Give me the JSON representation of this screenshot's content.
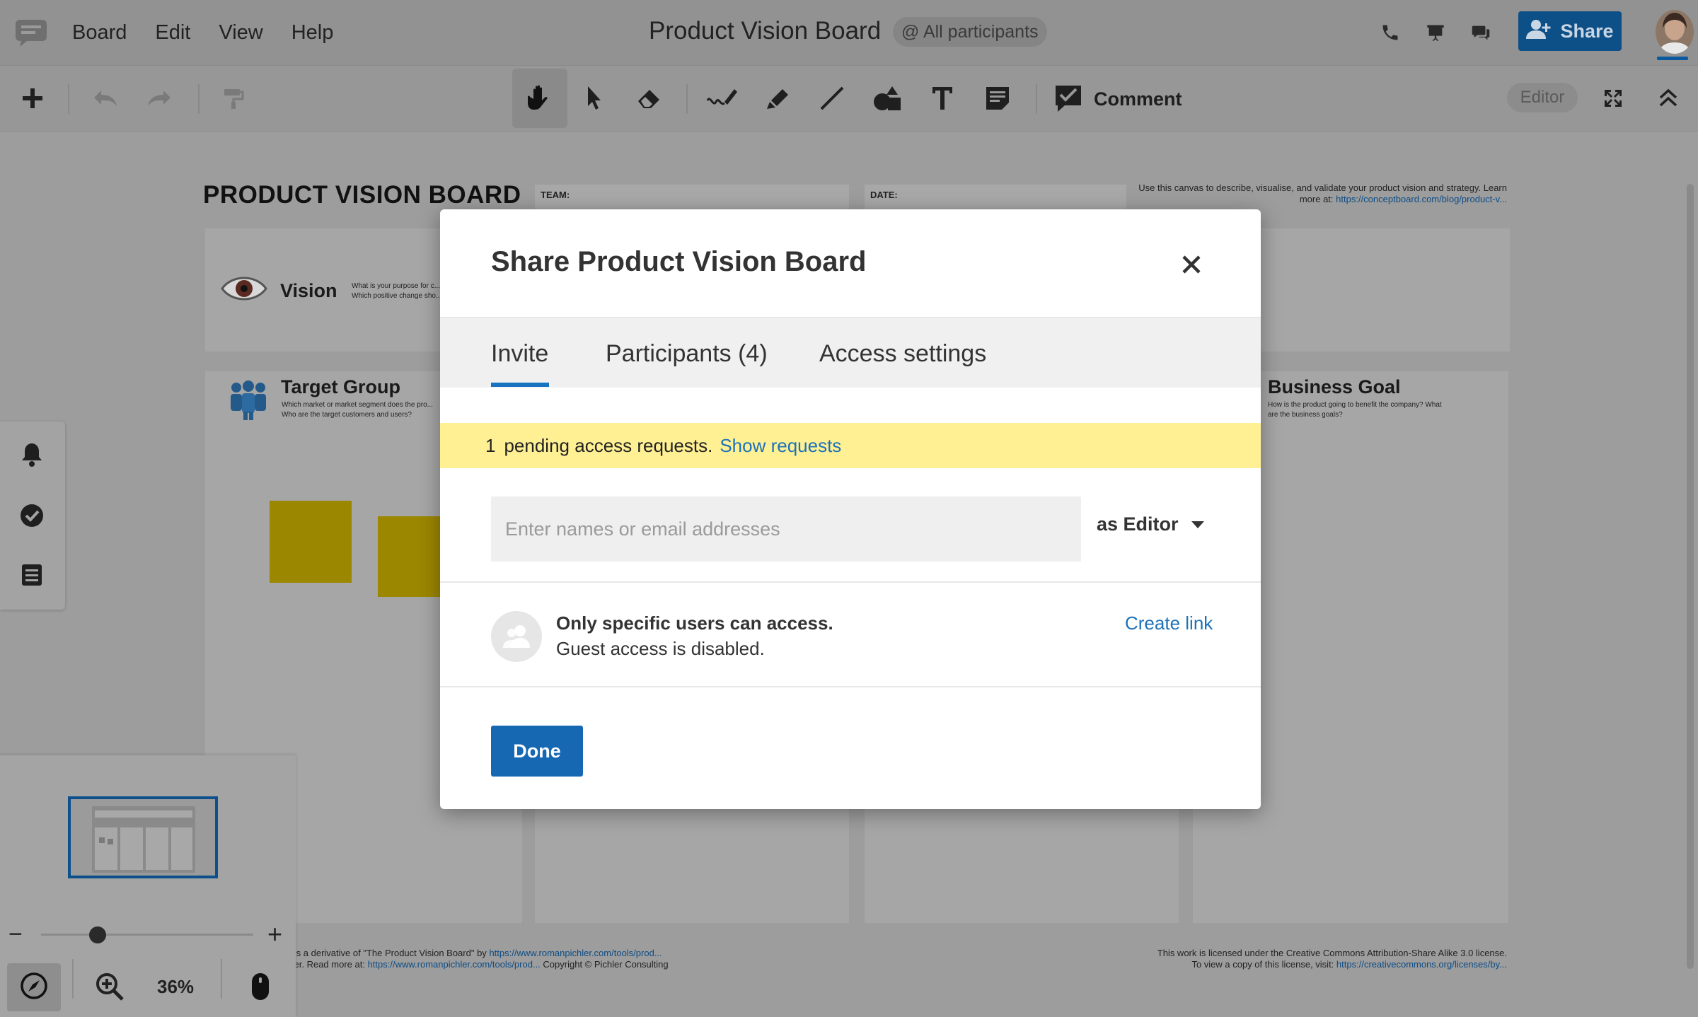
{
  "menubar": {
    "menu_items": [
      "Board",
      "Edit",
      "View",
      "Help"
    ],
    "board_title": "Product Vision Board",
    "participants_pill": "@ All participants",
    "share_label": "Share"
  },
  "toolbar": {
    "comment_label": "Comment",
    "mode_label": "Editor"
  },
  "canvas": {
    "board_heading": "PRODUCT VISION BOARD",
    "team_label": "TEAM:",
    "date_label": "DATE:",
    "intro_text": "Use this canvas to describe, visualise, and validate your product vision and strategy. Learn more at:",
    "intro_link": "https://conceptboard.com/blog/product-v...",
    "vision_label": "Vision",
    "vision_desc": "What is your purpose for c... Which positive change sho...",
    "target_group_label": "Target Group",
    "target_group_desc": "Which market or market segment does the pro... Who are the target customers and users?",
    "business_goal_label": "Business Goal",
    "business_goal_desc": "How is the product going to benefit the company? What are the business goals?",
    "footer_left_1": "rd\" is a derivative of \"The Product Vision Board\" by",
    "footer_left_link_1": "https://www.romanpichler.com/tools/prod...",
    "footer_left_2": "ichler. Read more at:",
    "footer_left_link_2": "https://www.romanpichler.com/tools/prod...",
    "footer_left_3": "Copyright © Pichler Consulting",
    "footer_right_1": "This work is licensed under the Creative Commons Attribution-Share Alike 3.0 license.",
    "footer_right_2": "To view a copy of this license, visit:",
    "footer_right_link": "https://creativecommons.org/licenses/by..."
  },
  "zoom": {
    "percent": "36%",
    "level_fraction": 0.36
  },
  "modal": {
    "title": "Share Product Vision Board",
    "tabs": [
      {
        "label": "Invite",
        "active": true
      },
      {
        "label": "Participants (4)",
        "active": false
      },
      {
        "label": "Access settings",
        "active": false
      }
    ],
    "pending_count": "1",
    "pending_text": "pending access requests.",
    "show_requests": "Show requests",
    "invite_placeholder": "Enter names or email addresses",
    "invite_value": "",
    "role_selected": "as Editor",
    "access_title": "Only specific users can access.",
    "access_subtitle": "Guest access is disabled.",
    "create_link": "Create link",
    "done_label": "Done"
  },
  "colors": {
    "accent": "#1768b3",
    "link": "#1d72b8",
    "pending_bg": "#fff094",
    "share_button_dimmed": "#0d4f87",
    "sticky_note": "#9c8700"
  },
  "icons": [
    "app-logo-icon",
    "phone-icon",
    "presentation-icon",
    "chat-icon",
    "add-user-icon",
    "plus-icon",
    "undo-icon",
    "redo-icon",
    "paint-roller-icon",
    "hand-icon",
    "pointer-icon",
    "eraser-icon",
    "pen-icon",
    "highlighter-icon",
    "line-icon",
    "shapes-icon",
    "text-icon",
    "sticky-note-icon",
    "comment-icon",
    "fullscreen-icon",
    "collapse-icon",
    "bell-icon",
    "check-circle-icon",
    "list-icon",
    "compass-icon",
    "zoom-in-icon",
    "mouse-icon",
    "close-icon",
    "users-icon",
    "eye-icon",
    "people-icon"
  ]
}
